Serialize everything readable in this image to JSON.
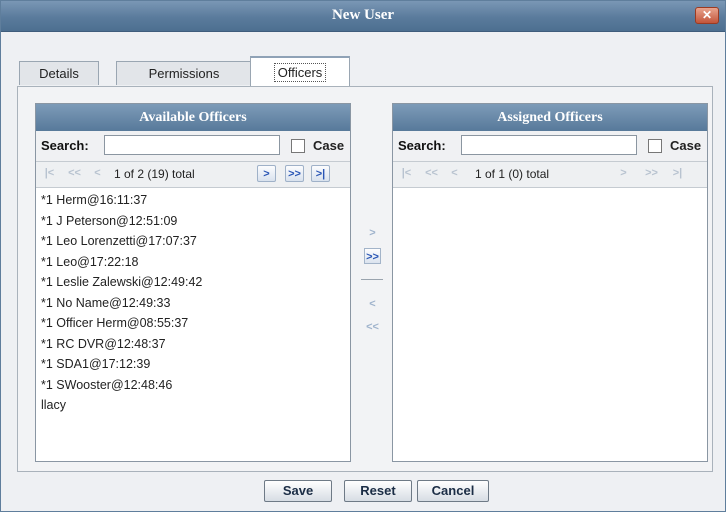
{
  "window": {
    "title": "New User",
    "close_glyph": "✕"
  },
  "tabs": [
    {
      "label": "Details",
      "active": false
    },
    {
      "label": "Permissions",
      "active": false
    },
    {
      "label": "Officers",
      "active": true
    }
  ],
  "available": {
    "header": "Available Officers",
    "search_label": "Search:",
    "search_value": "",
    "case_label": "Case",
    "case_checked": false,
    "pager_text": "1 of 2 (19) total",
    "pager_icons": {
      "first": "|<",
      "prev_page": "<<",
      "prev": "<",
      "next": ">",
      "next_page": ">>",
      "last": ">|"
    },
    "items": [
      "*1 Herm@16:11:37",
      "*1 J Peterson@12:51:09",
      "*1 Leo Lorenzetti@17:07:37",
      "*1 Leo@17:22:18",
      "*1 Leslie Zalewski@12:49:42",
      "*1 No Name@12:49:33",
      "*1 Officer Herm@08:55:37",
      "*1 RC DVR@12:48:37",
      "*1 SDA1@17:12:39",
      "*1 SWooster@12:48:46",
      "llacy"
    ]
  },
  "assigned": {
    "header": "Assigned Officers",
    "search_label": "Search:",
    "search_value": "",
    "case_label": "Case",
    "case_checked": false,
    "pager_text": "1 of 1 (0) total",
    "pager_icons": {
      "first": "|<",
      "prev_page": "<<",
      "prev": "<",
      "next": ">",
      "next_page": ">>",
      "last": ">|"
    },
    "items": []
  },
  "transfer": {
    "add": ">",
    "add_all": ">>",
    "remove": "<",
    "remove_all": "<<"
  },
  "footer": {
    "save": "Save",
    "reset": "Reset",
    "cancel": "Cancel"
  }
}
